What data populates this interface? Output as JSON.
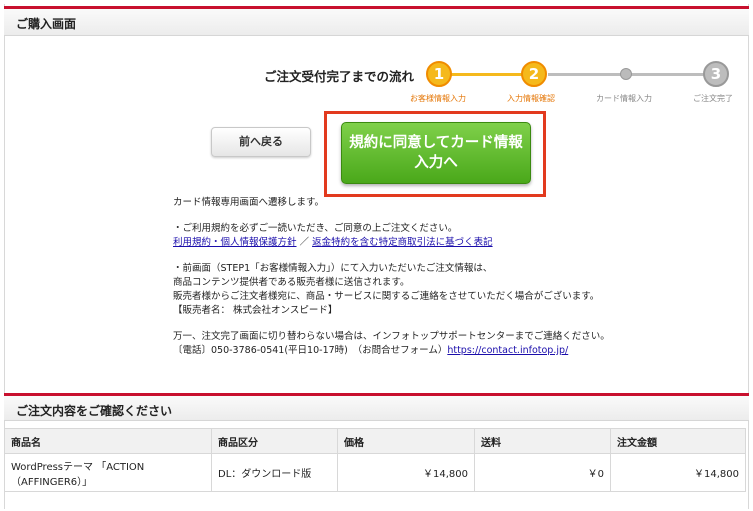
{
  "purchase_section": {
    "title": "ご購入画面"
  },
  "flow": {
    "title": "ご注文受付完了までの流れ",
    "steps": [
      {
        "number": "1",
        "label": "お客様情報入力",
        "state": "active"
      },
      {
        "number": "2",
        "label": "入力情報確認",
        "state": "active"
      },
      {
        "number": "",
        "label": "カード情報入力",
        "state": "upcoming"
      },
      {
        "number": "3",
        "label": "ご注文完了",
        "state": "upcoming"
      }
    ],
    "colors": {
      "active": "#f5b91c",
      "active_line": "#f5b91c",
      "inactive": "#bdbdbd"
    }
  },
  "buttons": {
    "back": "前へ戻る",
    "agree_line1": "規約に同意してカード情報",
    "agree_line2": "入力へ"
  },
  "notes": {
    "line1": "カード情報専用画面へ遷移します。",
    "line2": "・ご利用規約を必ずご一読いただき、ご同意の上ご注文ください。",
    "link_terms": "利用規約・個人情報保護方針",
    "link_sep": " ／ ",
    "link_law": "返金特約を含む特定商取引法に基づく表記",
    "line3": "・前画面（STEP1「お客様情報入力」）にて入力いただいたご注文情報は、",
    "line4": "商品コンテンツ提供者である販売者様に送信されます。",
    "line5": "販売者様からご注文者様宛に、商品・サービスに関するご連絡をさせていただく場合がございます。",
    "line6": "【販売者名： 株式会社オンスピード】",
    "line7": "万一、注文完了画面に切り替わらない場合は、インフォトップサポートセンターまでご連絡ください。",
    "line8": "〔電話〕050-3786-0541(平日10-17時)　（お問合せフォーム）",
    "contact_link": "https://contact.infotop.jp/"
  },
  "confirm_section": {
    "title": "ご注文内容をご確認ください"
  },
  "order_table": {
    "headers": [
      "商品名",
      "商品区分",
      "価格",
      "送料",
      "注文金額"
    ],
    "rows": [
      {
        "name_line1": "WordPressテーマ 「ACTION",
        "name_line2": "（AFFINGER6）」",
        "type": "DL：ダウンロード版",
        "price": "￥14,800",
        "shipping": "￥0",
        "total": "￥14,800"
      }
    ]
  }
}
